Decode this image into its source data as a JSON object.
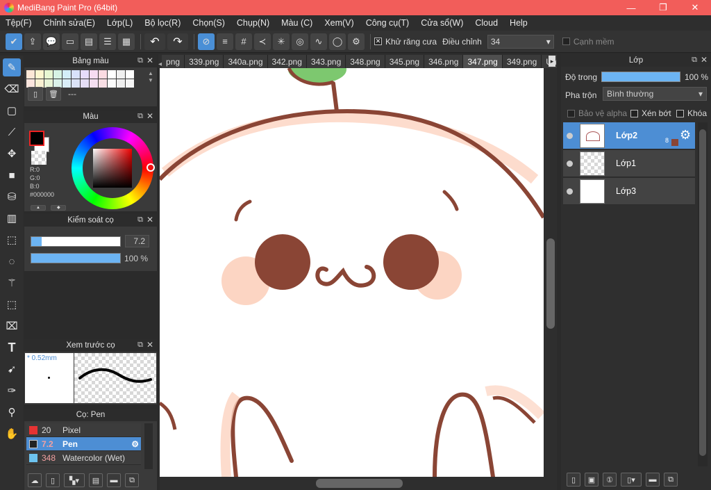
{
  "window": {
    "title": "MediBang Paint Pro (64bit)",
    "minimize": "—",
    "maximize": "❐",
    "close": "✕"
  },
  "menu": [
    "Tệp(F)",
    "Chỉnh sửa(E)",
    "Lớp(L)",
    "Bộ lọc(R)",
    "Chọn(S)",
    "Chụp(N)",
    "Màu (C)",
    "Xem(V)",
    "Công cụ(T)",
    "Cửa sổ(W)",
    "Cloud",
    "Help"
  ],
  "toolbar": {
    "antialias_label": "Khử răng cưa",
    "antialias_checked": true,
    "adjust_label": "Điều chỉnh",
    "adjust_value": "34",
    "soft_edge_label": "Cạnh mềm",
    "soft_edge_checked": false
  },
  "palette_panel": {
    "title": "Bảng màu",
    "palette_name": "---"
  },
  "color_panel": {
    "title": "Màu",
    "r": "R:0",
    "g": "G:0",
    "b": "B:0",
    "hex": "#000000"
  },
  "brush_control": {
    "title": "Kiểm soát cọ",
    "size": "7.2",
    "size_fraction": 0.12,
    "opacity": "100 %",
    "opacity_fraction": 1.0
  },
  "brush_preview": {
    "title": "Xem trước cọ",
    "size_label": "* 0.52mm"
  },
  "brush_list": {
    "title": "Cọ: Pen",
    "items": [
      {
        "size": "20",
        "name": "Pixel",
        "color": "#e53333",
        "selected": false
      },
      {
        "size": "7.2",
        "name": "Pen",
        "color": "#222222",
        "selected": true
      },
      {
        "size": "348",
        "name": "Watercolor (Wet)",
        "color": "#6dc4f0",
        "selected": false
      }
    ]
  },
  "tabs": [
    "png",
    "339.png",
    "340a.png",
    "342.png",
    "343.png",
    "348.png",
    "345.png",
    "346.png",
    "347.png",
    "349.png",
    "Untitled"
  ],
  "active_tab_index": 8,
  "layer_panel": {
    "title": "Lớp",
    "opacity_label": "Độ trong",
    "opacity_value": "100 %",
    "blend_label": "Pha trộn",
    "blend_value": "Bình thường",
    "protect_alpha_label": "Bảo vệ alpha",
    "clipping_label": "Xén bớt",
    "lock_label": "Khóa",
    "layers": [
      {
        "name": "Lớp2",
        "badge": "8",
        "selected": true
      },
      {
        "name": "Lớp1",
        "selected": false
      },
      {
        "name": "Lớp3",
        "selected": false
      }
    ]
  },
  "colors": {
    "accent": "#4d8ed4",
    "titlebar": "#f25d5a",
    "stroke": "#8a4535",
    "blush": "#fcd3c0"
  }
}
